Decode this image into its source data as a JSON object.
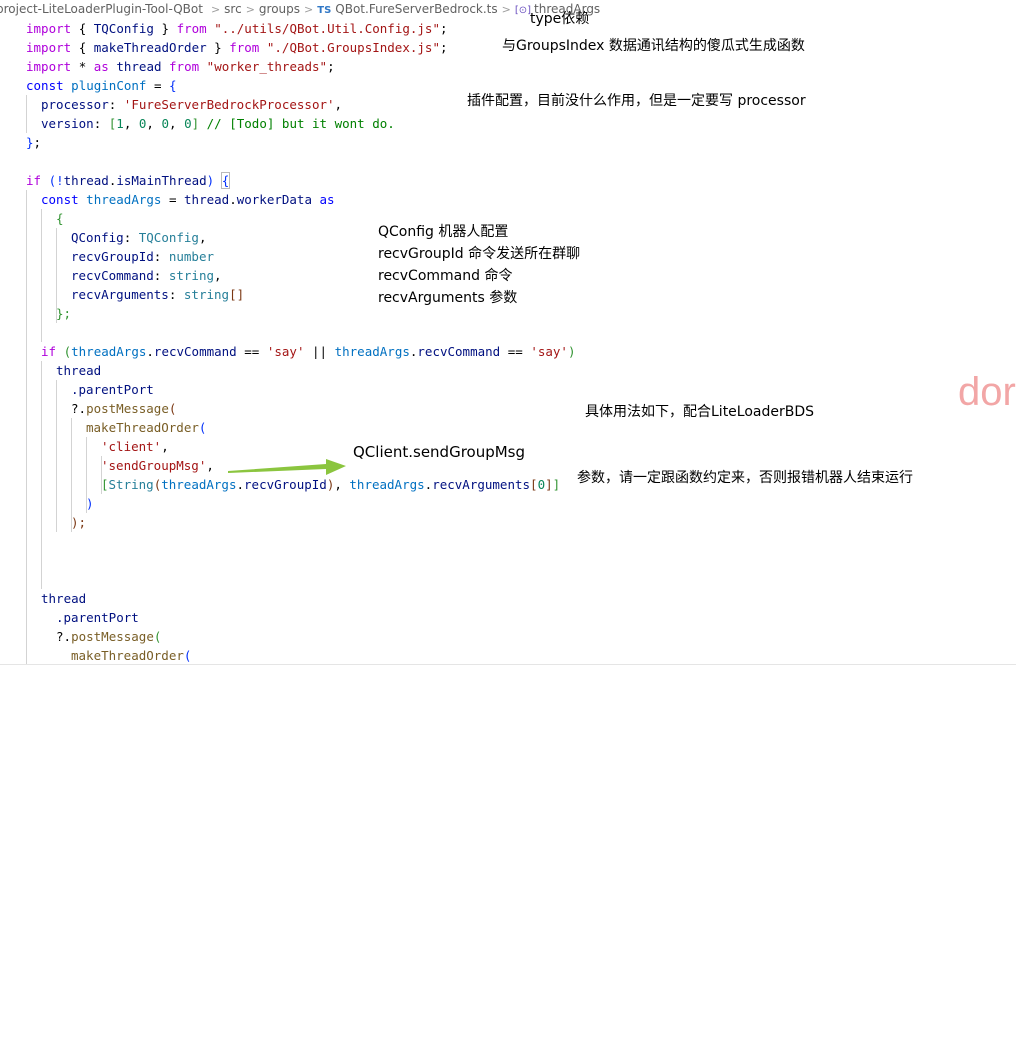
{
  "breadcrumb": {
    "project": "project-LiteLoaderPlugin-Tool-QBot",
    "src": "src",
    "groups": "groups",
    "ts_badge": "TS",
    "file": "QBot.FureServerBedrock.ts",
    "symbol_icon": "[⊙]",
    "symbol": "threadArgs"
  },
  "code": {
    "import1": {
      "kw": "import",
      "b1": "{ ",
      "name": "TQConfig",
      "b2": " }",
      "from": "from",
      "path": "\"../utils/QBot.Util.Config.js\"",
      "semi": ";"
    },
    "import2": {
      "kw": "import",
      "b1": "{ ",
      "name": "makeThreadOrder",
      "b2": " }",
      "from": "from",
      "path": "\"./QBot.GroupsIndex.js\"",
      "semi": ";"
    },
    "import3": {
      "kw": "import",
      "star": "*",
      "as": "as",
      "name": "thread",
      "from": "from",
      "path": "\"worker_threads\"",
      "semi": ";"
    },
    "conf_decl": {
      "kw": "const",
      "name": "pluginConf",
      "eq": "=",
      "brace": "{"
    },
    "conf_processor": {
      "key": "processor",
      "colon": ":",
      "val": "'FureServerBedrockProcessor'",
      "comma": ","
    },
    "conf_version": {
      "key": "version",
      "colon": ":",
      "ob": "[",
      "n1": "1",
      "n2": "0",
      "n3": "0",
      "n4": "0",
      "cb": "]",
      "comment": "// [Todo] but it wont do."
    },
    "conf_close": {
      "brace": "}",
      "semi": ";"
    },
    "if_main": {
      "kw": "if",
      "op": "(!",
      "obj": "thread",
      "prop": "isMainThread",
      "cp": ")",
      "brace": "{"
    },
    "args_decl": {
      "kw": "const",
      "name": "threadArgs",
      "eq": "=",
      "obj": "thread",
      "prop": "workerData",
      "as": "as"
    },
    "type_open": "{",
    "type_qconfig": {
      "key": "QConfig",
      "colon": ":",
      "type": "TQConfig",
      "comma": ","
    },
    "type_group": {
      "key": "recvGroupId",
      "colon": ":",
      "type": "number"
    },
    "type_command": {
      "key": "recvCommand",
      "colon": ":",
      "type": "string",
      "comma": ","
    },
    "type_args": {
      "key": "recvArguments",
      "colon": ":",
      "type": "string",
      "arr": "[]"
    },
    "type_close": "};",
    "if_cmd": {
      "kw": "if",
      "op": "(",
      "a1": "threadArgs",
      "p1": "recvCommand",
      "eq1": "==",
      "s1": "'say'",
      "or": "||",
      "a2": "threadArgs",
      "p2": "recvCommand",
      "eq2": "==",
      "s2": "'say'",
      "cp": ")"
    },
    "thread1": "thread",
    "parent1": ".parentPort",
    "post1": {
      "q": "?.",
      "fn": "postMessage",
      "p": "("
    },
    "make1": {
      "fn": "makeThreadOrder",
      "p": "("
    },
    "arg_client": {
      "val": "'client'",
      "comma": ","
    },
    "arg_send": {
      "val": "'sendGroupMsg'",
      "comma": ","
    },
    "arg_arr": {
      "ob": "[",
      "fn": "String",
      "op": "(",
      "a1": "threadArgs",
      "p1": "recvGroupId",
      "cp": ")",
      "comma": ",",
      "a2": "threadArgs",
      "p2": "recvArguments",
      "ib": "[",
      "idx": "0",
      "icb": "]",
      "cb": "]"
    },
    "close_make": ")",
    "close_post": ");",
    "thread2": "thread",
    "parent2": ".parentPort",
    "post2": {
      "q": "?.",
      "fn": "postMessage",
      "p": "("
    },
    "make2": {
      "fn": "makeThreadOrder",
      "p": "("
    }
  },
  "notes": {
    "type_dep": "type依赖",
    "groups_index": "与GroupsIndex 数据通讯结构的傻瓜式生成函数",
    "plugin_conf": "插件配置，目前没什么作用，但是一定要写 processor",
    "qconfig": "QConfig 机器人配置",
    "recv_group": "recvGroupId 命令发送所在群聊",
    "recv_command": "recvCommand 命令",
    "recv_args": "recvArguments 参数",
    "usage": "具体用法如下，配合LiteLoaderBDS",
    "send_group": "QClient.sendGroupMsg",
    "params": "参数，请一定跟函数约定来，否则报错机器人结束运行",
    "red_fragment": "dor"
  },
  "colors": {
    "keyword": "#0000ff",
    "control_keyword": "#af00db",
    "string": "#a31515",
    "number": "#098658",
    "comment": "#008000",
    "type": "#267f99",
    "variable": "#001080",
    "function": "#795e26",
    "arrow": "#8bc53f",
    "red_fragment": "#f2a6a6"
  }
}
